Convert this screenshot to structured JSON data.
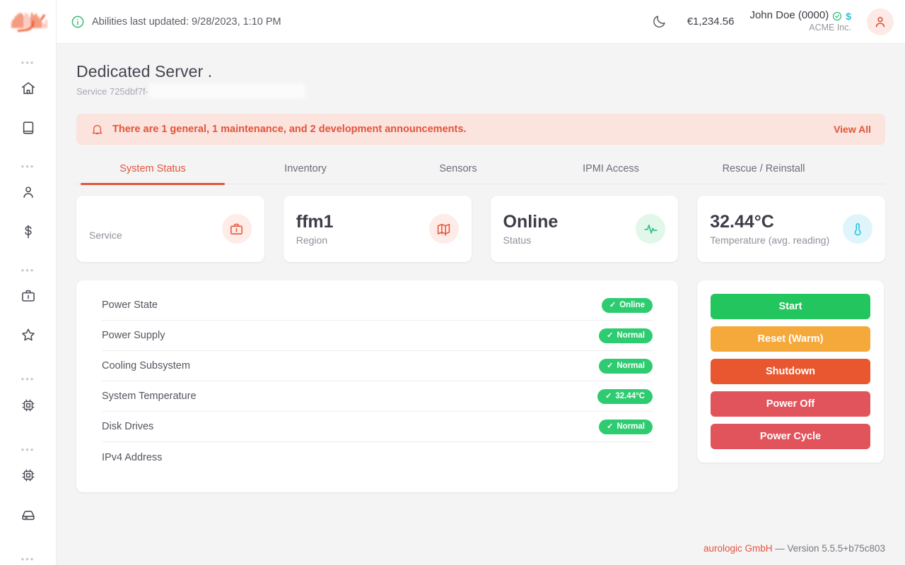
{
  "sidebar": {
    "logo_name": "aurologic-logo",
    "groups": [
      {
        "separator": "•••",
        "items": [
          {
            "name": "home-icon",
            "label": "Home"
          },
          {
            "name": "book-icon",
            "label": "Documentation"
          }
        ]
      },
      {
        "separator": "•••",
        "items": [
          {
            "name": "user-icon",
            "label": "Account"
          },
          {
            "name": "dollar-icon",
            "label": "Billing"
          }
        ]
      },
      {
        "separator": "•••",
        "items": [
          {
            "name": "briefcase-icon",
            "label": "Services"
          },
          {
            "name": "star-icon",
            "label": "Favorites"
          }
        ]
      },
      {
        "separator": "•••",
        "items": [
          {
            "name": "cpu-icon",
            "label": "Servers"
          }
        ]
      },
      {
        "separator": "•••",
        "items": [
          {
            "name": "cpu-icon",
            "label": "Dedicated"
          },
          {
            "name": "server-icon",
            "label": "Storage"
          }
        ]
      },
      {
        "separator": "•••",
        "items": []
      }
    ]
  },
  "header": {
    "info_icon": "info-circle-icon",
    "updated_text": "Abilities last updated: 9/28/2023, 1:10 PM",
    "theme_toggle_icon": "moon-icon",
    "balance": "€1,234.56",
    "user_name": "John Doe (0000)",
    "verified_icon": "check-circle-icon",
    "dollar_badge": "$",
    "user_org": "ACME Inc.",
    "avatar_icon": "user-avatar-icon"
  },
  "page": {
    "title": "Dedicated Server .",
    "subtitle": "Service 725dbf7f-"
  },
  "announcement": {
    "icon": "bell-icon",
    "text": "There are 1 general, 1 maintenance, and 2 development announcements.",
    "view_all_label": "View All"
  },
  "tabs": [
    {
      "label": "System Status",
      "active": true
    },
    {
      "label": "Inventory",
      "active": false
    },
    {
      "label": "Sensors",
      "active": false
    },
    {
      "label": "IPMI Access",
      "active": false
    },
    {
      "label": "Rescue / Reinstall",
      "active": false
    }
  ],
  "stat_cards": [
    {
      "value": "",
      "label": "Service",
      "icon": "briefcase-icon",
      "icon_style": "ico-orange"
    },
    {
      "value": "ffm1",
      "label": "Region",
      "icon": "map-icon",
      "icon_style": "ico-orange"
    },
    {
      "value": "Online",
      "label": "Status",
      "icon": "activity-icon",
      "icon_style": "ico-green"
    },
    {
      "value": "32.44°C",
      "label": "Temperature (avg. reading)",
      "icon": "thermometer-icon",
      "icon_style": "ico-cyan"
    }
  ],
  "status_rows": [
    {
      "label": "Power State",
      "badge": "Online",
      "has_badge": true
    },
    {
      "label": "Power Supply",
      "badge": "Normal",
      "has_badge": true
    },
    {
      "label": "Cooling Subsystem",
      "badge": "Normal",
      "has_badge": true
    },
    {
      "label": "System Temperature",
      "badge": "32.44°C",
      "has_badge": true
    },
    {
      "label": "Disk Drives",
      "badge": "Normal",
      "has_badge": true
    },
    {
      "label": "IPv4 Address",
      "badge": "",
      "has_badge": false
    }
  ],
  "badge_check_glyph": "✓",
  "actions": [
    {
      "label": "Start",
      "color": "#2ecc71"
    },
    {
      "label": "Reset (Warm)",
      "color": "#f6a councils"
    },
    {
      "label": "Shutdown",
      "color": "#e8572f"
    },
    {
      "label": "Power Off",
      "color": "#e2545c"
    },
    {
      "label": "Power Cycle",
      "color": "#e2545c"
    }
  ],
  "action_colors": [
    "#22c55e",
    "#f6a93b",
    "#e8572f",
    "#e2545c",
    "#e2545c"
  ],
  "footer": {
    "brand": "aurologic GmbH",
    "version": " — Version 5.5.5+b75c803"
  },
  "colors": {
    "accent": "#e2543a",
    "success": "#2ecc71",
    "bg": "#f4f4f5"
  }
}
